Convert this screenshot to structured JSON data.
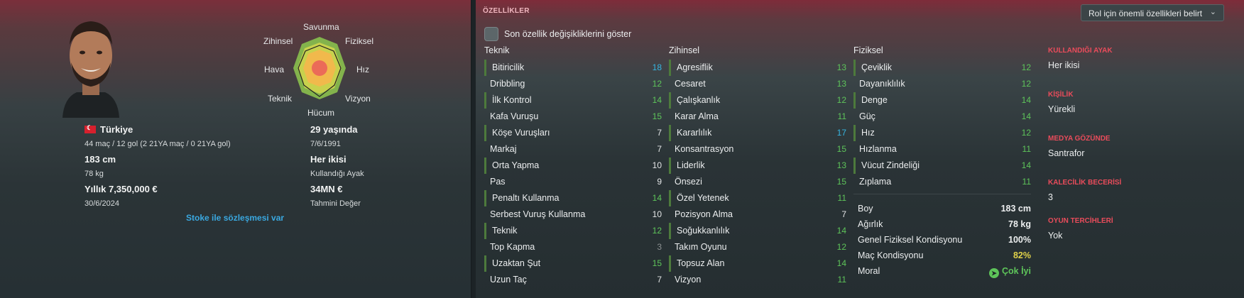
{
  "overview": {
    "nation": "Türkiye",
    "caps": "44 maç / 12 gol (2 21YA maç / 0 21YA gol)",
    "age": "29 yaşında",
    "dob": "7/6/1991",
    "height": "183 cm",
    "weight": "78 kg",
    "foot": "Her ikisi",
    "foot_label": "Kullandığı Ayak",
    "wage": "Yıllık 7,350,000 €",
    "contract_end": "30/6/2024",
    "value": "34MN €",
    "value_label": "Tahmini Değer",
    "contract_link": "Stoke ile sözleşmesi var",
    "radar_labels": {
      "top": "Savunma",
      "top_right": "Fiziksel",
      "right": "Hız",
      "bottom_right": "Vizyon",
      "bottom": "Hücum",
      "bottom_left": "Teknik",
      "left": "Hava",
      "top_left": "Zihinsel"
    }
  },
  "attributes": {
    "section_title": "ÖZELLİKLER",
    "role_button": "Rol için önemli özellikleri belirt",
    "show_changes": "Son özellik değişikliklerini göster",
    "technical": {
      "title": "Teknik",
      "items": [
        {
          "name": "Bitiricilik",
          "value": "18"
        },
        {
          "name": "Dribbling",
          "value": "12"
        },
        {
          "name": "İlk Kontrol",
          "value": "14"
        },
        {
          "name": "Kafa Vuruşu",
          "value": "15"
        },
        {
          "name": "Köşe Vuruşları",
          "value": "7"
        },
        {
          "name": "Markaj",
          "value": "7"
        },
        {
          "name": "Orta Yapma",
          "value": "10"
        },
        {
          "name": "Pas",
          "value": "9"
        },
        {
          "name": "Penaltı Kullanma",
          "value": "14"
        },
        {
          "name": "Serbest Vuruş Kullanma",
          "value": "10"
        },
        {
          "name": "Teknik",
          "value": "12"
        },
        {
          "name": "Top Kapma",
          "value": "3"
        },
        {
          "name": "Uzaktan Şut",
          "value": "15"
        },
        {
          "name": "Uzun Taç",
          "value": "7"
        }
      ]
    },
    "mental": {
      "title": "Zihinsel",
      "items": [
        {
          "name": "Agresiflik",
          "value": "13"
        },
        {
          "name": "Cesaret",
          "value": "13"
        },
        {
          "name": "Çalışkanlık",
          "value": "12"
        },
        {
          "name": "Karar Alma",
          "value": "11"
        },
        {
          "name": "Kararlılık",
          "value": "17"
        },
        {
          "name": "Konsantrasyon",
          "value": "15"
        },
        {
          "name": "Liderlik",
          "value": "13"
        },
        {
          "name": "Önsezi",
          "value": "15"
        },
        {
          "name": "Özel Yetenek",
          "value": "11"
        },
        {
          "name": "Pozisyon Alma",
          "value": "7"
        },
        {
          "name": "Soğukkanlılık",
          "value": "14"
        },
        {
          "name": "Takım Oyunu",
          "value": "12"
        },
        {
          "name": "Topsuz Alan",
          "value": "14"
        },
        {
          "name": "Vizyon",
          "value": "11"
        }
      ]
    },
    "physical": {
      "title": "Fiziksel",
      "items": [
        {
          "name": "Çeviklik",
          "value": "12"
        },
        {
          "name": "Dayanıklılık",
          "value": "12"
        },
        {
          "name": "Denge",
          "value": "14"
        },
        {
          "name": "Güç",
          "value": "14"
        },
        {
          "name": "Hız",
          "value": "12"
        },
        {
          "name": "Hızlanma",
          "value": "11"
        },
        {
          "name": "Vücut Zindeliği",
          "value": "14"
        },
        {
          "name": "Zıplama",
          "value": "11"
        }
      ]
    },
    "physical_info": [
      {
        "label": "Boy",
        "value": "183 cm"
      },
      {
        "label": "Ağırlık",
        "value": "78 kg"
      },
      {
        "label": "Genel Fiziksel Kondisyonu",
        "value": "100%"
      },
      {
        "label": "Maç Kondisyonu",
        "value": "82%"
      },
      {
        "label": "Moral",
        "value": "Çok İyi"
      }
    ],
    "side_info": [
      {
        "label": "KULLANDIĞI AYAK",
        "value": "Her ikisi"
      },
      {
        "label": "KİŞİLİK",
        "value": "Yürekli"
      },
      {
        "label": "MEDYA GÖZÜNDE",
        "value": "Santrafor"
      },
      {
        "label": "KALECİLİK BECERİSİ",
        "value": "3"
      },
      {
        "label": "OYUN TERCİHLERİ",
        "value": "Yok"
      }
    ]
  },
  "colors": {
    "accent_red": "#ea4c5b",
    "attr_blue": "#36b5e0",
    "attr_green": "#5ec55a",
    "link_blue": "#3aa8e0"
  }
}
